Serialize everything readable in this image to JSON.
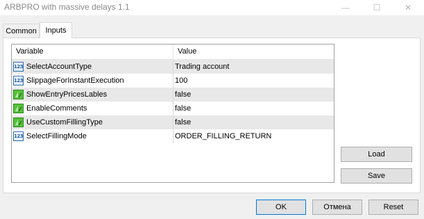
{
  "window": {
    "title": "ARBPRO with massive delays 1.1"
  },
  "tabs": [
    {
      "label": "Common"
    },
    {
      "label": "Inputs"
    }
  ],
  "grid": {
    "columns": {
      "variable": "Variable",
      "value": "Value"
    },
    "rows": [
      {
        "icon": "numeric-icon",
        "variable": "SelectAccountType",
        "value": "Trading account"
      },
      {
        "icon": "numeric-icon",
        "variable": "SlippageForInstantExecution",
        "value": "100"
      },
      {
        "icon": "boolean-icon",
        "variable": "ShowEntryPricesLables",
        "value": "false"
      },
      {
        "icon": "boolean-icon",
        "variable": "EnableComments",
        "value": "false"
      },
      {
        "icon": "boolean-icon",
        "variable": "UseCustomFillingType",
        "value": "false"
      },
      {
        "icon": "numeric-icon",
        "variable": "SelectFillingMode",
        "value": "ORDER_FILLING_RETURN"
      }
    ]
  },
  "side_buttons": {
    "load": "Load",
    "save": "Save"
  },
  "footer_buttons": {
    "ok": "OK",
    "cancel": "Отмена",
    "reset": "Reset"
  },
  "icons": {
    "numeric_icon_text": "123"
  },
  "colors": {
    "ok_border": "#0078d7",
    "row_alt": "#e8e8e8"
  }
}
